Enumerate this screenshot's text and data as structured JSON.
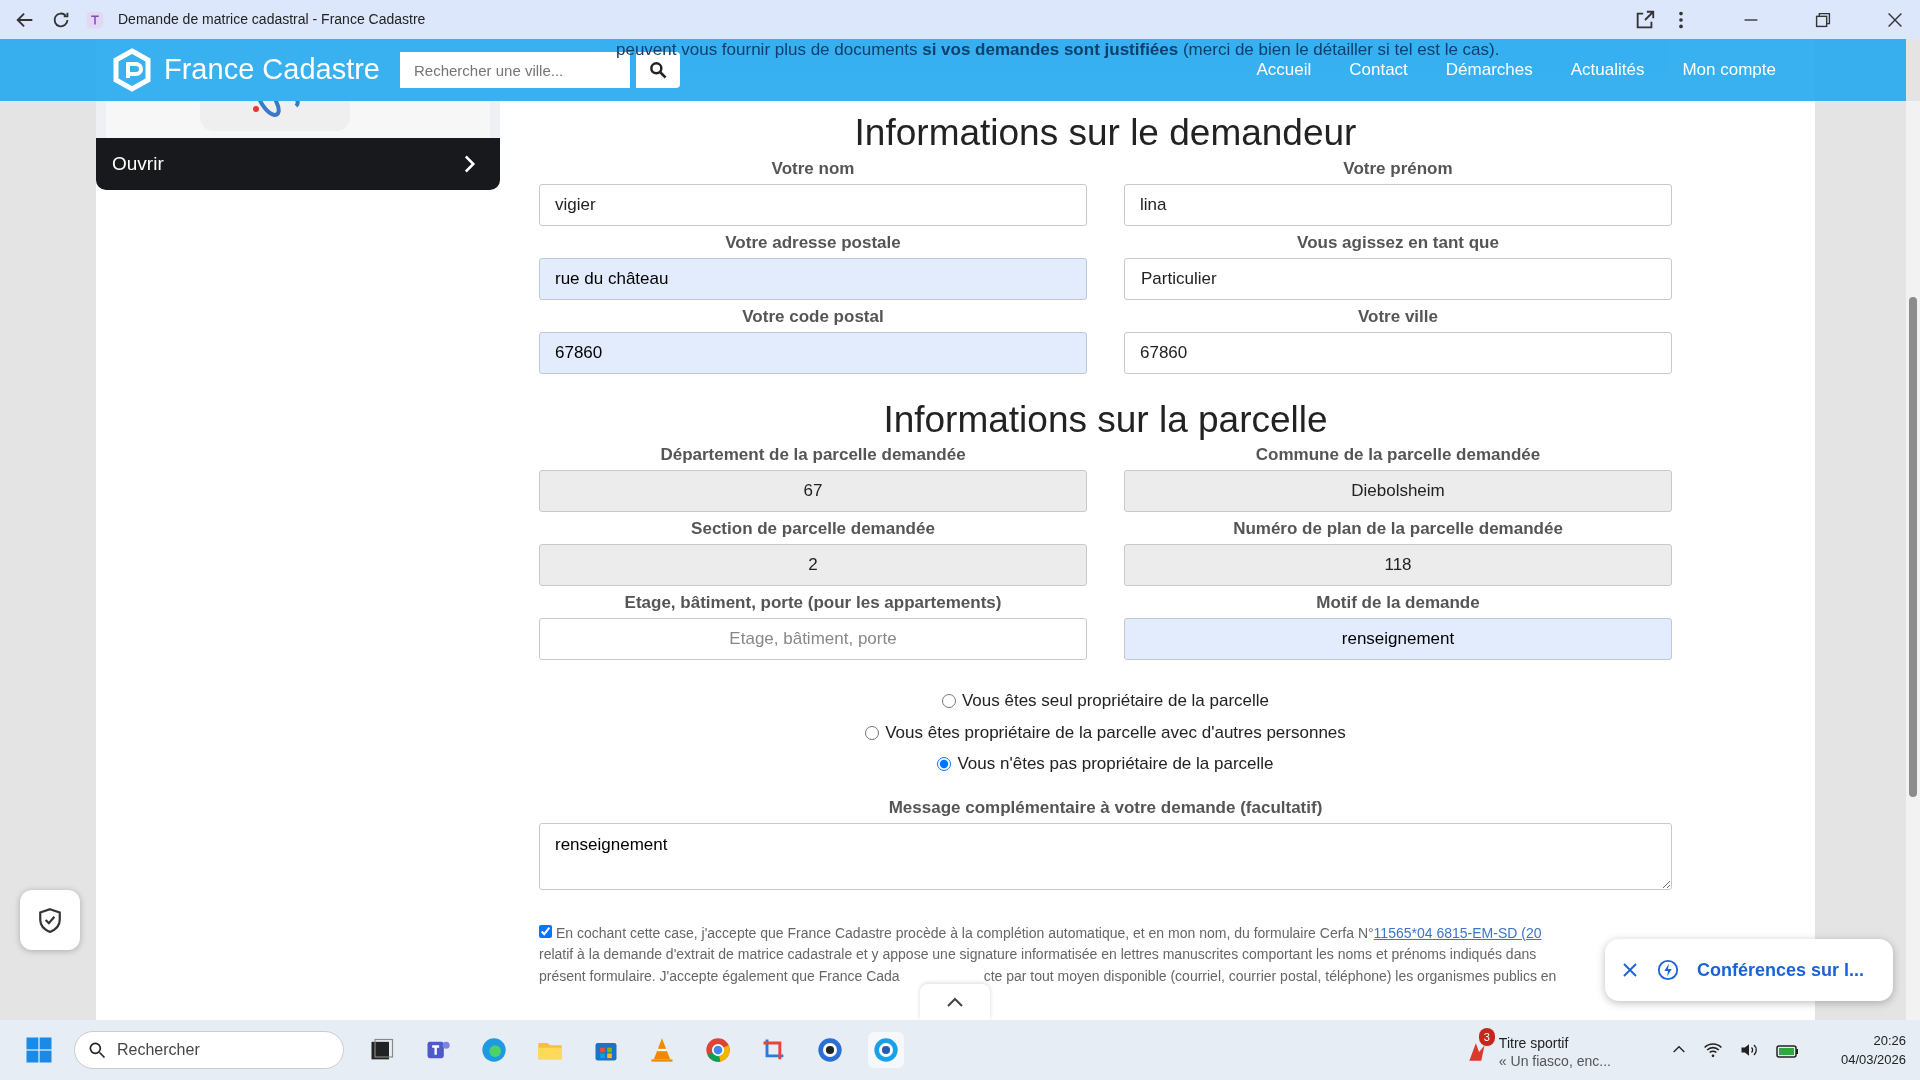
{
  "browser": {
    "tab_title": "Demande de matrice cadastral - France Cadastre"
  },
  "navbar": {
    "brand": "France Cadastre",
    "search_placeholder": "Rechercher une ville...",
    "links": [
      "Accueil",
      "Contact",
      "Démarches",
      "Actualités",
      "Mon compte"
    ],
    "notice_behind": "peuvent vous fournir plus de documents **si vos demandes sont justifiées** (merci de bien le détailler si tel est le cas)."
  },
  "sidebar": {
    "open_button": "Ouvrir"
  },
  "sections": [
    {
      "title": "Informations sur le demandeur",
      "fields": [
        {
          "label": "Votre nom",
          "value": "vigier",
          "kind": "text",
          "autofilled": false,
          "readonly": false
        },
        {
          "label": "Votre prénom",
          "value": "lina",
          "kind": "text",
          "autofilled": false,
          "readonly": false
        },
        {
          "label": "Votre adresse postale",
          "value": "rue du château",
          "kind": "text",
          "autofilled": true,
          "readonly": false
        },
        {
          "label": "Vous agissez en tant que",
          "value": "Particulier",
          "kind": "select",
          "autofilled": false,
          "readonly": false
        },
        {
          "label": "Votre code postal",
          "value": "67860",
          "kind": "text",
          "autofilled": true,
          "readonly": false
        },
        {
          "label": "Votre ville",
          "value": "67860",
          "kind": "text",
          "autofilled": false,
          "readonly": false
        }
      ]
    },
    {
      "title": "Informations sur la parcelle",
      "fields": [
        {
          "label": "Département de la parcelle demandée",
          "value": "67",
          "kind": "centered",
          "autofilled": false,
          "readonly": true
        },
        {
          "label": "Commune de la parcelle demandée",
          "value": "Diebolsheim",
          "kind": "centered",
          "autofilled": false,
          "readonly": true
        },
        {
          "label": "Section de parcelle demandée",
          "value": "2",
          "kind": "centered",
          "autofilled": false,
          "readonly": true
        },
        {
          "label": "Numéro de plan de la parcelle demandée",
          "value": "118",
          "kind": "centered",
          "autofilled": false,
          "readonly": true
        },
        {
          "label": "Etage, bâtiment, porte (pour les appartements)",
          "placeholder": "Etage, bâtiment, porte",
          "kind": "centered",
          "autofilled": false,
          "readonly": false
        },
        {
          "label": "Motif de la demande",
          "value": "renseignement",
          "kind": "centered",
          "autofilled": true,
          "readonly": false
        }
      ]
    }
  ],
  "ownership": [
    {
      "label": "Vous êtes seul propriétaire de la parcelle",
      "selected": false
    },
    {
      "label": "Vous êtes propriétaire de la parcelle avec d'autres personnes",
      "selected": false
    },
    {
      "label": "Vous n'êtes pas propriétaire de la parcelle",
      "selected": true
    }
  ],
  "message": {
    "label": "Message complémentaire à votre demande (facultatif)",
    "value": "renseignement"
  },
  "consent": {
    "checked": true,
    "line_1": "En cochant cette case, j'accepte que France Cadastre procède à la complétion automatique, et en mon nom, du formulaire Cerfa N°",
    "link": "11565*04 6815-EM-SD (20",
    "line_2": "relatif à la demande d'extrait de matrice cadastrale et y appose une signature informatisée en lettres manuscrites comportant les noms et prénoms indiqués dans",
    "line_3a": "présent formulaire. J'accepte également que France Cada",
    "line_3b": "cte par tout moyen disponible (courriel, courrier postal, téléphone) les organismes publics en"
  },
  "toast": {
    "text": "Conférences sur l..."
  },
  "taskbar": {
    "search": "Rechercher",
    "news_title": "Titre sportif",
    "news_sub": "« Un fiasco, enc...",
    "news_badge": "3",
    "time": "20:26",
    "date": "04/03/2026"
  }
}
